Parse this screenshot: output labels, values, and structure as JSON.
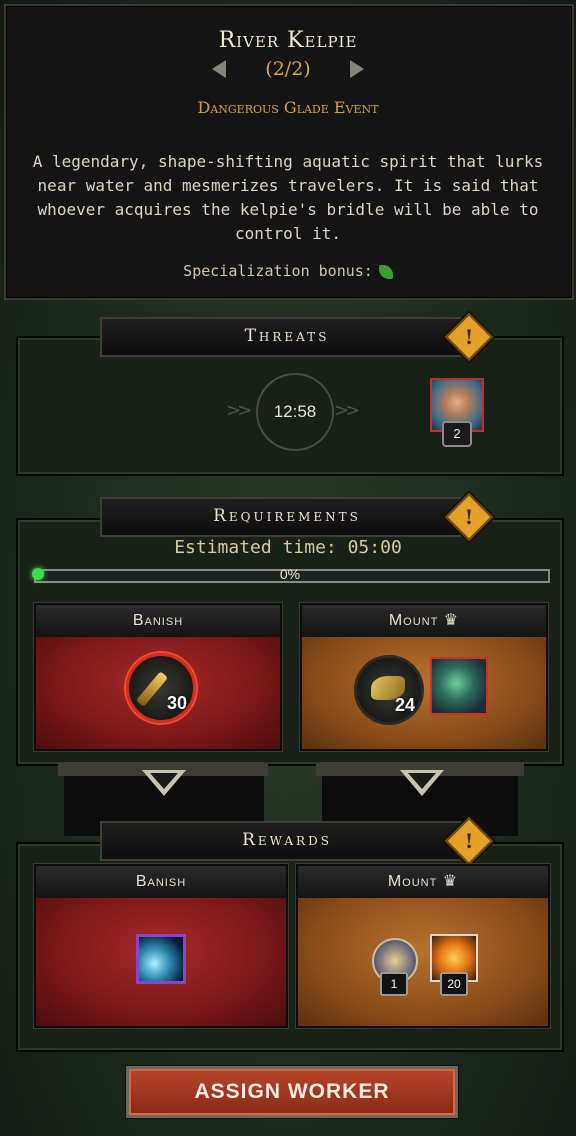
{
  "event": {
    "title": "River Kelpie",
    "pager": "(2/2)",
    "type": "Dangerous Glade Event",
    "description": "A legendary, shape-shifting aquatic spirit that lurks near water and mesmerizes travelers. It is said that whoever acquires the kelpie's bridle will be able to control it.",
    "specialization_label": "Specialization bonus:",
    "specialization_icon": "leaf-icon"
  },
  "threats": {
    "title": "Threats",
    "timer": "12:58",
    "threat_count": "2",
    "threat_icon": "raised-hand-icon"
  },
  "requirements": {
    "title": "Requirements",
    "estimated_time": "Estimated time: 05:00",
    "progress_label": "0%",
    "progress": 0,
    "banish": {
      "label": "Banish",
      "count": "30",
      "icon": "sword-resource-icon"
    },
    "mount": {
      "label": "Mount",
      "count": "24",
      "icon": "fiber-resource-icon",
      "creature_icon": "kelpie-portrait-icon"
    }
  },
  "rewards": {
    "title": "Rewards",
    "banish": {
      "label": "Banish",
      "icon": "blue-magic-icon"
    },
    "mount": {
      "label": "Mount",
      "item1_count": "1",
      "item2_count": "20",
      "item1_icon": "crown-medallion-icon",
      "item2_icon": "amber-resource-icon"
    }
  },
  "assign_button": "ASSIGN WORKER",
  "colors": {
    "accent_gold": "#d9a54a",
    "banish_red": "#8a1c1d",
    "mount_amber": "#a0602a",
    "info_orange": "#e3a12a"
  }
}
